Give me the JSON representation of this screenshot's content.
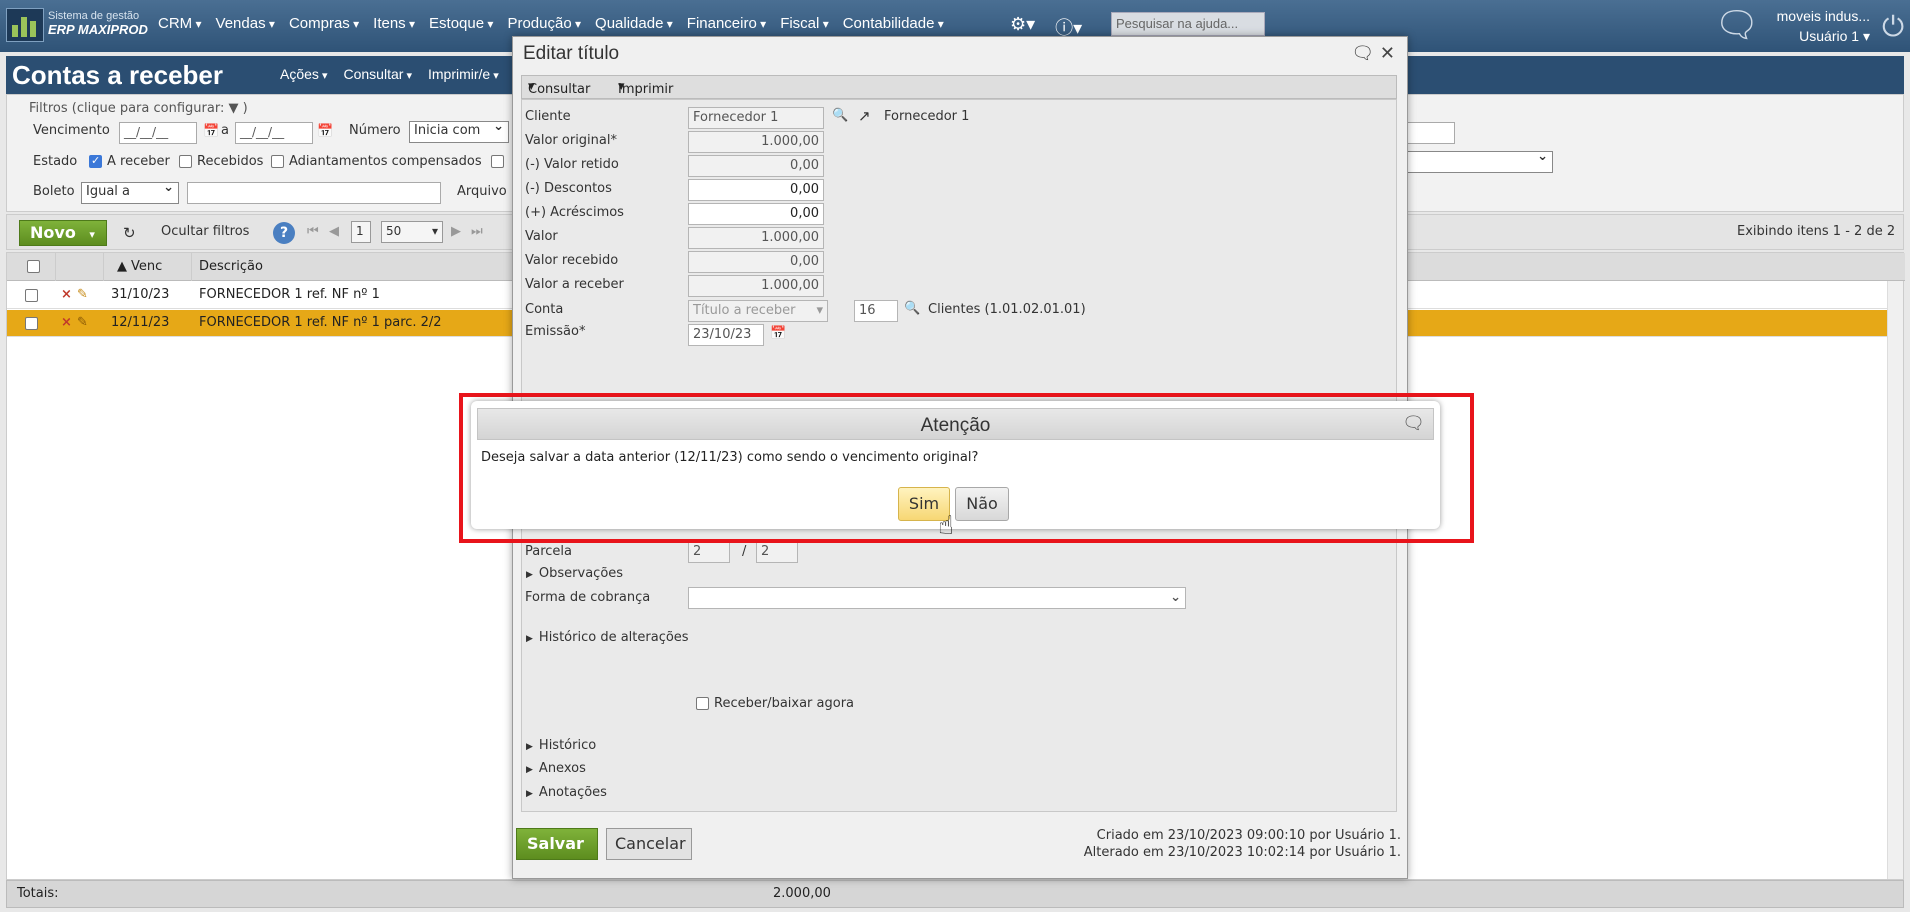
{
  "topbar": {
    "logo_line1": "Sistema de gestão",
    "logo_line2": "ERP MAXIPROD",
    "menu": [
      "CRM",
      "Vendas",
      "Compras",
      "Itens",
      "Estoque",
      "Produção",
      "Qualidade",
      "Financeiro",
      "Fiscal",
      "Contabilidade"
    ],
    "help_placeholder": "Pesquisar na ajuda...",
    "company": "moveis indus...",
    "user": "Usuário 1"
  },
  "page": {
    "title": "Contas a receber",
    "menu": [
      "Ações",
      "Consultar",
      "Imprimir/e"
    ]
  },
  "filters": {
    "legend": "Filtros (clique para configurar:",
    "legend_end": ")",
    "vencimento_label": "Vencimento",
    "date_mask": "__/__/__",
    "a_label": "a",
    "numero_label": "Número",
    "numero_select": "Inicia com",
    "estado_label": "Estado",
    "a_receber": "A receber",
    "recebidos": "Recebidos",
    "adiantamentos": "Adiantamentos compensados",
    "boleto_label": "Boleto",
    "boleto_select": "Igual a",
    "arquivo_label": "Arquivo"
  },
  "toolbar": {
    "novo": "Novo",
    "ocultar": "Ocultar filtros",
    "page": "1",
    "per_page": "50",
    "info": "Exibindo itens 1 - 2 de 2"
  },
  "grid": {
    "col_venc": "Venc",
    "col_desc": "Descrição",
    "rows": [
      {
        "venc": "31/10/23",
        "desc": "FORNECEDOR 1 ref. NF nº 1"
      },
      {
        "venc": "12/11/23",
        "desc": "FORNECEDOR 1 ref. NF nº 1 parc. 2/2"
      }
    ],
    "totals_label": "Totais:",
    "totals_value": "2.000,00"
  },
  "edit": {
    "title": "Editar título",
    "tb_consultar": "Consultar",
    "tb_imprimir": "Imprimir",
    "cliente_label": "Cliente",
    "cliente_value": "Fornecedor 1",
    "cliente_link": "Fornecedor 1",
    "valor_original_label": "Valor original*",
    "valor_original": "1.000,00",
    "valor_retido_label": "(-) Valor retido",
    "valor_retido": "0,00",
    "descontos_label": "(-) Descontos",
    "descontos": "0,00",
    "acrescimos_label": "(+) Acréscimos",
    "acrescimos": "0,00",
    "valor_label": "Valor",
    "valor": "1.000,00",
    "valor_recebido_label": "Valor recebido",
    "valor_recebido": "0,00",
    "valor_a_receber_label": "Valor a receber",
    "valor_a_receber": "1.000,00",
    "conta_label": "Conta",
    "conta_select": "Título a receber",
    "conta_num": "16",
    "conta_desc": "Clientes (1.01.02.01.01)",
    "emissao_label": "Emissão*",
    "emissao": "23/10/23",
    "parcela_label": "Parcela",
    "parcela_atual": "2",
    "parcela_sep": "/",
    "parcela_total": "2",
    "observacoes": "Observações",
    "forma_cobranca_label": "Forma de cobrança",
    "historico_alteracoes": "Histórico de alterações",
    "receber_agora": "Receber/baixar agora",
    "historico": "Histórico",
    "anexos": "Anexos",
    "anotacoes": "Anotações",
    "salvar": "Salvar",
    "cancelar": "Cancelar",
    "criado": "Criado em 23/10/2023 09:00:10 por Usuário 1.",
    "alterado": "Alterado em 23/10/2023 10:02:14 por Usuário 1."
  },
  "alert": {
    "title": "Atenção",
    "message": "Deseja salvar a data anterior (12/11/23) como sendo o vencimento original?",
    "yes": "Sim",
    "no": "Não"
  },
  "colors": {
    "highlight": "#e8141b",
    "selected_row": "#e6a817",
    "primary_button": "#6a9a26",
    "topbar": "#2f5377"
  }
}
